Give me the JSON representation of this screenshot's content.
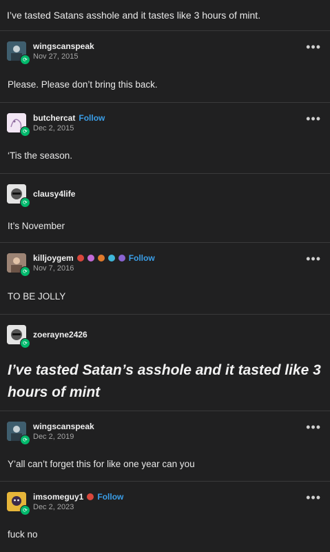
{
  "header": {
    "text": "I’ve tasted Satans asshole and it tastes like 3 hours of mint."
  },
  "follow_label": "Follow",
  "posts": [
    {
      "username": "wingscanspeak",
      "date": "Nov 27, 2015",
      "body": "Please. Please don’t bring this back.",
      "avatar_color": "#5a7a8a"
    },
    {
      "username": "butchercat",
      "date": "Dec 2, 2015",
      "body": "‘Tis the season.",
      "avatar_color": "#e8d6ee"
    },
    {
      "username": "clausy4life",
      "date": "",
      "body": "It’s November",
      "avatar_color": "#dcdcdc"
    },
    {
      "username": "killjoygem",
      "date": "Nov 7, 2016",
      "body": "TO BE JOLLY",
      "avatar_color": "#b79a86"
    },
    {
      "username": "zoerayne2426",
      "date": "",
      "body": "I’ve tasted Satan’s asshole and it tasted like 3 hours of mint",
      "avatar_color": "#dcdcdc"
    },
    {
      "username": "wingscanspeak",
      "date": "Dec 2, 2019",
      "body": "Y’all can’t forget this for like one year can you",
      "avatar_color": "#5a7a8a"
    },
    {
      "username": "imsomeguy1",
      "date": "Dec 2, 2023",
      "body": "fuck no",
      "avatar_color": "#d7a227"
    }
  ],
  "icons": {
    "reblog": "reblog-icon",
    "more": "more-options-icon"
  },
  "colors": {
    "background": "#202021",
    "follow": "#3a9ee8",
    "reblog_badge": "#00b86b"
  }
}
